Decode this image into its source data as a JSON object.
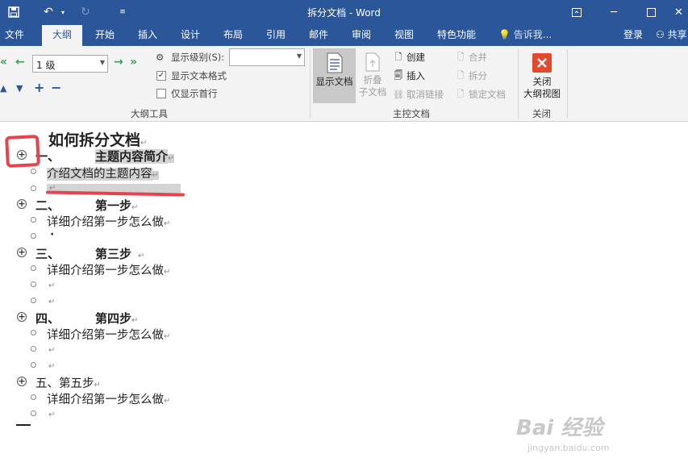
{
  "titlebar": {
    "title": "拆分文档 - Word"
  },
  "tabs": [
    "文件",
    "大纲",
    "开始",
    "插入",
    "设计",
    "布局",
    "引用",
    "邮件",
    "审阅",
    "视图",
    "特色功能"
  ],
  "tell_me": "告诉我...",
  "login": "登录",
  "share": "共享",
  "ribbon": {
    "outline_tools": {
      "level_value": "1 级",
      "show_level_label": "显示级别(S):",
      "show_level_value": "",
      "show_text_format": "显示文本格式",
      "show_text_format_checked": true,
      "first_line_only": "仅显示首行",
      "first_line_only_checked": false,
      "group_label": "大纲工具"
    },
    "master_doc": {
      "show_doc": "显示文档",
      "collapse_sub_1": "折叠",
      "collapse_sub_2": "子文档",
      "create": "创建",
      "insert": "插入",
      "unlink": "取消链接",
      "merge": "合并",
      "split": "拆分",
      "lock": "锁定文档",
      "group_label": "主控文档"
    },
    "close": {
      "label_1": "关闭",
      "label_2": "大纲视图",
      "group_label": "关闭"
    }
  },
  "document": {
    "title": "如何拆分文档",
    "items": [
      {
        "num": "一、",
        "heading": "主题内容简介",
        "body": "介绍文档的主题内容"
      },
      {
        "num": "二、",
        "heading": "第一步",
        "body": "详细介绍第一步怎么做"
      },
      {
        "num": "三、",
        "heading": "第三步",
        "body": "详细介绍第一步怎么做"
      },
      {
        "num": "四、",
        "heading": "第四步",
        "body": "详细介绍第一步怎么做"
      },
      {
        "num": "五、",
        "heading": "第五步",
        "body": "详细介绍第一步怎么做"
      }
    ],
    "para_mark": "↵",
    "dot": "·"
  },
  "watermark": {
    "line1": "Bai 经验",
    "line2": "jingyan.baidu.com"
  },
  "colors": {
    "word_blue": "#2b579a",
    "annotation_red": "#e5444f",
    "close_red": "#e04b2e"
  }
}
